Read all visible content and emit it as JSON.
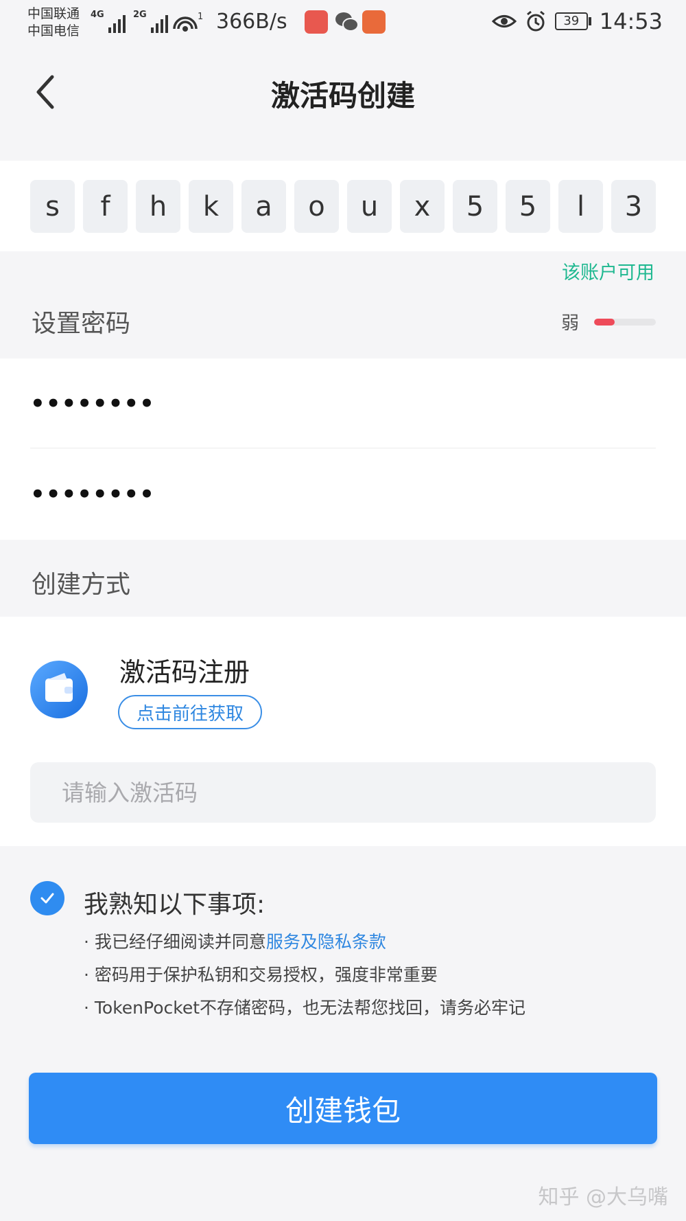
{
  "status_bar": {
    "carrier1": "中国联通",
    "carrier2": "中国电信",
    "net1": "4G",
    "net2": "2G",
    "hotspot": "1",
    "speed": "366B/s",
    "battery": "39",
    "time": "14:53"
  },
  "nav": {
    "title": "激活码创建"
  },
  "activation_code": {
    "chars": [
      "s",
      "f",
      "h",
      "k",
      "a",
      "o",
      "u",
      "x",
      "5",
      "5",
      "l",
      "3"
    ],
    "availability": "该账户可用"
  },
  "password": {
    "label": "设置密码",
    "strength_label": "弱",
    "strength_level": 0.33,
    "field1_value": "••••••••",
    "field2_value": "••••••••"
  },
  "method": {
    "label": "创建方式",
    "name": "激活码注册",
    "get_button": "点击前往获取",
    "input_placeholder": "请输入激活码"
  },
  "agreement": {
    "checked": true,
    "title": "我熟知以下事项:",
    "line1_prefix": "· 我已经仔细阅读并同意",
    "line1_link": "服务及隐私条款",
    "line2": "· 密码用于保护私钥和交易授权，强度非常重要",
    "line3": "· TokenPocket不存储密码，也无法帮您找回，请务必牢记"
  },
  "create_button": "创建钱包",
  "watermark": "知乎 @大乌嘴",
  "colors": {
    "primary": "#2f8cf5",
    "available": "#1fb890",
    "weak": "#ee4b5a",
    "background": "#f5f5f7"
  }
}
